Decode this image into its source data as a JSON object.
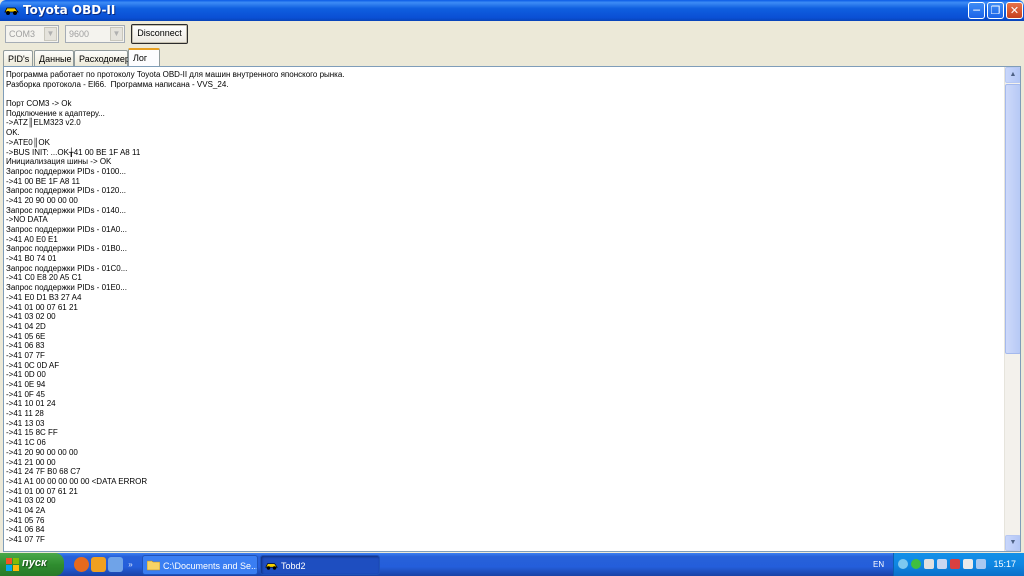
{
  "window": {
    "title": "Toyota OBD-II"
  },
  "toolbar": {
    "port": "COM3",
    "baud": "9600",
    "disconnect_label": "Disconnect"
  },
  "tabs": [
    "PID's",
    "Данные",
    "Расходомер",
    "Лог"
  ],
  "active_tab": "Лог",
  "log": {
    "lines": [
      "Программа работает по протоколу Toyota OBD-II для машин внутренного японского рынка.",
      "Разборка протокола - El66.  Программа написана - VVS_24.",
      "",
      "Порт COM3 -> Ok",
      "Подключение к адаптеру...",
      "->ATZ║ELM323 v2.0",
      "OK.",
      "->ATE0║OK",
      "->BUS INIT: ...OK╁41 00 BE 1F A8 11",
      "Инициализация шины -> OK",
      "Запрос поддержки PIDs - 0100...",
      "->41 00 BE 1F A8 11",
      "Запрос поддержки PIDs - 0120...",
      "->41 20 90 00 00 00",
      "Запрос поддержки PIDs - 0140...",
      "->NO DATA",
      "Запрос поддержки PIDs - 01A0...",
      "->41 A0 E0 E1",
      "Запрос поддержки PIDs - 01B0...",
      "->41 B0 74 01",
      "Запрос поддержки PIDs - 01C0...",
      "->41 C0 E8 20 A5 C1",
      "Запрос поддержки PIDs - 01E0...",
      "->41 E0 D1 B3 27 A4",
      "->41 01 00 07 61 21",
      "->41 03 02 00",
      "->41 04 2D",
      "->41 05 6E",
      "->41 06 83",
      "->41 07 7F",
      "->41 0C 0D AF",
      "->41 0D 00",
      "->41 0E 94",
      "->41 0F 45",
      "->41 10 01 24",
      "->41 11 28",
      "->41 13 03",
      "->41 15 8C FF",
      "->41 1C 06",
      "->41 20 90 00 00 00",
      "->41 21 00 00",
      "->41 24 7F B0 68 C7",
      "->41 A1 00 00 00 00 00 <DATA ERROR",
      "->41 01 00 07 61 21",
      "->41 03 02 00",
      "->41 04 2A",
      "->41 05 76",
      "->41 06 84",
      "->41 07 7F"
    ]
  },
  "taskbar": {
    "start_label": "пуск",
    "tasks": [
      "C:\\Documents and Se...",
      "Tobd2"
    ],
    "language": "EN",
    "clock": "15:17"
  }
}
